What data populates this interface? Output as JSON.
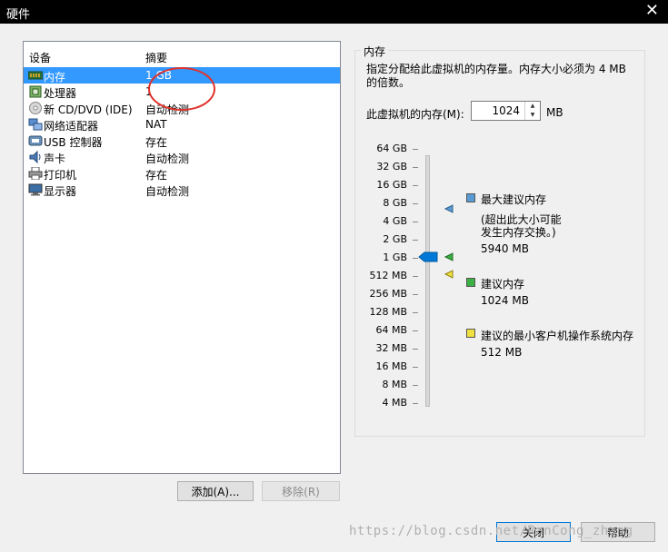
{
  "window": {
    "title": "硬件"
  },
  "devices": {
    "header_device": "设备",
    "header_summary": "摘要",
    "items": [
      {
        "name": "内存",
        "summary": "1 GB",
        "icon": "memory-icon"
      },
      {
        "name": "处理器",
        "summary": "1",
        "icon": "processor-icon"
      },
      {
        "name": "新 CD/DVD (IDE)",
        "summary": "自动检测",
        "icon": "cd-dvd-icon"
      },
      {
        "name": "网络适配器",
        "summary": "NAT",
        "icon": "network-adapter-icon"
      },
      {
        "name": "USB 控制器",
        "summary": "存在",
        "icon": "usb-icon"
      },
      {
        "name": "声卡",
        "summary": "自动检测",
        "icon": "sound-card-icon"
      },
      {
        "name": "打印机",
        "summary": "存在",
        "icon": "printer-icon"
      },
      {
        "name": "显示器",
        "summary": "自动检测",
        "icon": "display-icon"
      }
    ],
    "selected_index": 0
  },
  "buttons": {
    "add": "添加(A)...",
    "remove": "移除(R)",
    "close": "关闭",
    "help": "帮助"
  },
  "memory": {
    "group_title": "内存",
    "description": "指定分配给此虚拟机的内存量。内存大小必须为 4 MB 的倍数。",
    "label": "此虚拟机的内存(M):",
    "value": "1024",
    "unit": "MB",
    "scale": [
      "64 GB",
      "32 GB",
      "16 GB",
      "8 GB",
      "4 GB",
      "2 GB",
      "1 GB",
      "512 MB",
      "256 MB",
      "128 MB",
      "64 MB",
      "32 MB",
      "16 MB",
      "8 MB",
      "4 MB"
    ],
    "current_index": 6,
    "legend": {
      "max_title": "最大建议内存",
      "max_note_1": "(超出此大小可能",
      "max_note_2": "发生内存交换。)",
      "max_value": "5940 MB",
      "rec_title": "建议内存",
      "rec_value": "1024 MB",
      "min_title": "建议的最小客户机操作系统内存",
      "min_value": "512 MB"
    }
  },
  "colors": {
    "selection": "#3399ff",
    "max_marker": "#5b9bd5",
    "rec_marker": "#3cb043",
    "min_marker": "#f0e040",
    "annotation": "#e0312a"
  },
  "watermark": "https://blog.csdn.net/RanCong_zhang"
}
